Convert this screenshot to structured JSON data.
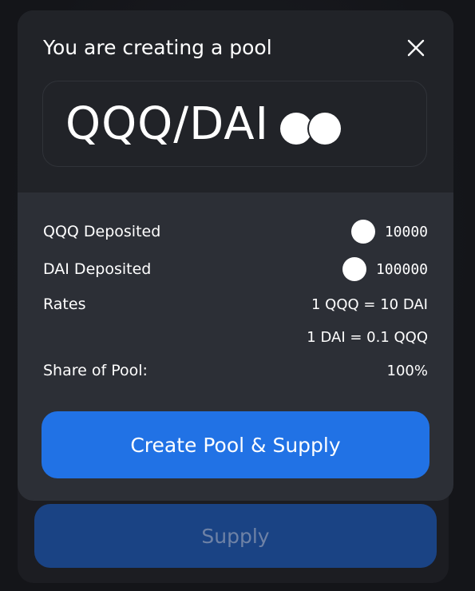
{
  "modal": {
    "title": "You are creating a pool",
    "pair": "QQQ/DAI",
    "token_a_logo_icon": "token-logo-placeholder",
    "token_b_logo_icon": "token-logo-placeholder",
    "close_icon": "close-icon"
  },
  "details": {
    "token_a_deposited": {
      "label": "QQQ Deposited",
      "value": "10000"
    },
    "token_b_deposited": {
      "label": "DAI Deposited",
      "value": "100000"
    },
    "rates": {
      "label": "Rates",
      "rate_a": "1 QQQ = 10 DAI",
      "rate_b": "1 DAI = 0.1 QQQ"
    },
    "share": {
      "label": "Share of Pool:",
      "value": "100%"
    }
  },
  "actions": {
    "create_label": "Create Pool & Supply",
    "supply_label": "Supply"
  },
  "colors": {
    "accent": "#2172e5",
    "modal_background": "#2c2f36",
    "modal_header_background": "#212328",
    "supply_disabled": "#1a4384"
  }
}
